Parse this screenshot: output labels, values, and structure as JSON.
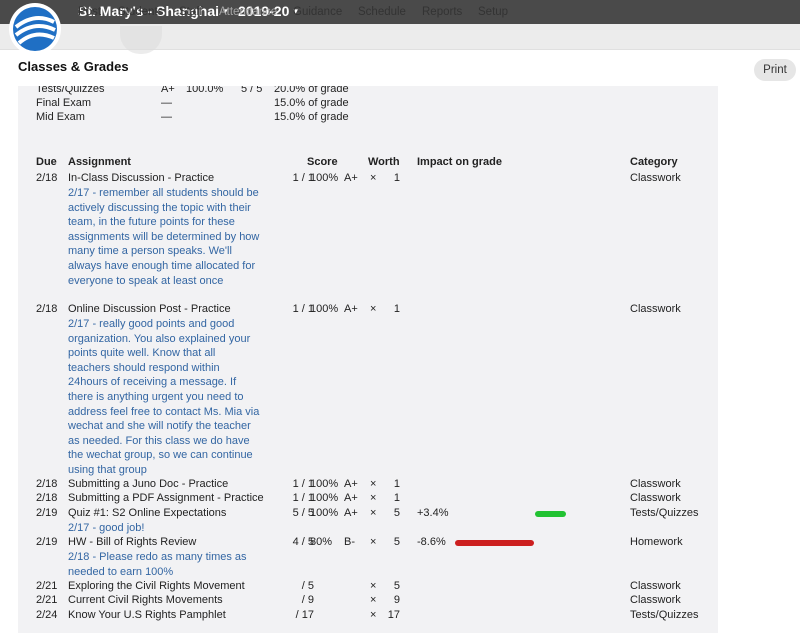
{
  "topbar": {
    "logo_icon": "school-logo-icon",
    "school": "St. Mary's - Shanghai",
    "year": "2019-20",
    "caret": "▾"
  },
  "nav": {
    "items": [
      {
        "label": "Post",
        "disabled": false
      },
      {
        "label": "Students",
        "disabled": false
      },
      {
        "label": "Staff",
        "disabled": false
      },
      {
        "label": "Attendance",
        "disabled": true
      },
      {
        "label": "Guidance",
        "disabled": false
      },
      {
        "label": "Schedule",
        "disabled": false
      },
      {
        "label": "Reports",
        "disabled": false
      },
      {
        "label": "Setup",
        "disabled": false
      }
    ]
  },
  "page": {
    "title": "Classes & Grades",
    "print_label": "Print"
  },
  "categories": [
    {
      "name": "Tests/Quizzes",
      "grade": "A+",
      "pct": "100.0%",
      "pts": "5 / 5",
      "weight": "20.0% of grade"
    },
    {
      "name": "Final Exam",
      "grade": "—",
      "pct": "",
      "pts": "",
      "weight": "15.0% of grade"
    },
    {
      "name": "Mid Exam",
      "grade": "—",
      "pct": "",
      "pts": "",
      "weight": "15.0% of grade"
    }
  ],
  "table": {
    "headers": {
      "due": "Due",
      "assignment": "Assignment",
      "score": "Score",
      "worth": "Worth",
      "impact": "Impact on grade",
      "category": "Category"
    },
    "rows": [
      {
        "due": "2/18",
        "name": "In-Class Discussion - Practice",
        "pts": "1 / 1",
        "pct": "100%",
        "grade": "A+",
        "x": "×",
        "worth": "1",
        "impact": "",
        "impact_value": 0,
        "category": "Classwork",
        "comment": "2/17 - remember all students should be actively discussing the topic with their team, in the future points for these assignments will be determined by how many time a person speaks. We'll always have enough time allocated for everyone to speak at least once"
      },
      {
        "due": "2/18",
        "name": "Online Discussion Post - Practice",
        "pts": "1 / 1",
        "pct": "100%",
        "grade": "A+",
        "x": "×",
        "worth": "1",
        "impact": "",
        "impact_value": 0,
        "category": "Classwork",
        "comment": "2/17 - really good points and good organization. You also explained your points quite well. Know that all teachers should respond within 24hours of receiving a message. If there is anything urgent you need to address feel free to contact Ms. Mia via wechat and she will notify the teacher as needed. For this class we do have the wechat group, so we can continue using that group"
      },
      {
        "due": "2/18",
        "name": "Submitting a Juno Doc - Practice",
        "pts": "1 / 1",
        "pct": "100%",
        "grade": "A+",
        "x": "×",
        "worth": "1",
        "impact": "",
        "impact_value": 0,
        "category": "Classwork",
        "comment": ""
      },
      {
        "due": "2/18",
        "name": "Submitting a PDF Assignment - Practice",
        "pts": "1 / 1",
        "pct": "100%",
        "grade": "A+",
        "x": "×",
        "worth": "1",
        "impact": "",
        "impact_value": 0,
        "category": "Classwork",
        "comment": ""
      },
      {
        "due": "2/19",
        "name": "Quiz #1: S2 Online Expectations",
        "pts": "5 / 5",
        "pct": "100%",
        "grade": "A+",
        "x": "×",
        "worth": "5",
        "impact": "+3.4%",
        "impact_value": 3.4,
        "category": "Tests/Quizzes",
        "comment": "2/17 - good job!"
      },
      {
        "due": "2/19",
        "name": "HW - Bill of Rights Review",
        "pts": "4 / 5",
        "pct": "80%",
        "grade": "B-",
        "x": "×",
        "worth": "5",
        "impact": "-8.6%",
        "impact_value": -8.6,
        "category": "Homework",
        "comment": "2/18 - Please redo as many times as needed to earn 100%"
      },
      {
        "due": "2/21",
        "name": "Exploring the Civil Rights Movement",
        "pts": "/ 5",
        "pct": "",
        "grade": "",
        "x": "×",
        "worth": "5",
        "impact": "",
        "impact_value": 0,
        "category": "Classwork",
        "comment": ""
      },
      {
        "due": "2/21",
        "name": "Current Civil Rights Movements",
        "pts": "/ 9",
        "pct": "",
        "grade": "",
        "x": "×",
        "worth": "9",
        "impact": "",
        "impact_value": 0,
        "category": "Classwork",
        "comment": ""
      },
      {
        "due": "2/24",
        "name": "Know Your U.S Rights Pamphlet",
        "pts": "/ 17",
        "pct": "",
        "grade": "",
        "x": "×",
        "worth": "17",
        "impact": "",
        "impact_value": 0,
        "category": "Tests/Quizzes",
        "comment": ""
      }
    ]
  },
  "colors": {
    "topbar": "#4a4a4a",
    "nav_bg": "#ececec",
    "panel_bg": "#f2f2f4",
    "comment_text": "#3366a3",
    "positive_bar": "#22c232",
    "negative_bar": "#cc1f1f",
    "logo_blue": "#1f6fc4"
  }
}
